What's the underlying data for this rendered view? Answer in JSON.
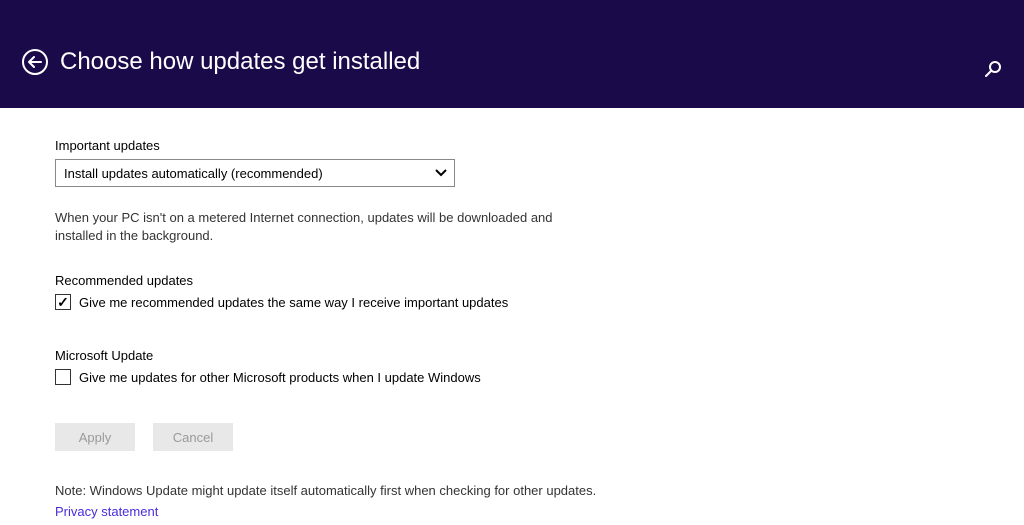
{
  "header": {
    "title": "Choose how updates get installed"
  },
  "sections": {
    "important": {
      "label": "Important updates",
      "selected": "Install updates automatically (recommended)",
      "description": "When your PC isn't on a metered Internet connection, updates will be downloaded and installed in the background."
    },
    "recommended": {
      "label": "Recommended updates",
      "checkbox_label": "Give me recommended updates the same way I receive important updates",
      "checked": true
    },
    "microsoft": {
      "label": "Microsoft Update",
      "checkbox_label": "Give me updates for other Microsoft products when I update Windows",
      "checked": false
    }
  },
  "buttons": {
    "apply": "Apply",
    "cancel": "Cancel"
  },
  "footer": {
    "note": "Note: Windows Update might update itself automatically first when checking for other updates.",
    "privacy": "Privacy statement"
  }
}
